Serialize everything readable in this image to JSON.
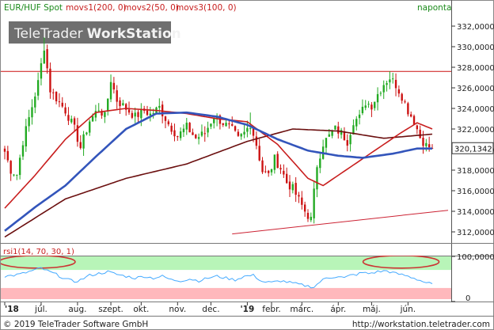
{
  "header": {
    "instrument": "EUR/HUF Spot",
    "indicators": [
      "movs1(200, 0)",
      "movs2(50, 0)",
      "movs3(100, 0)"
    ],
    "period": "naponta"
  },
  "watermark": {
    "brand_light": "TeleTrader",
    "brand_bold": "WorkStation"
  },
  "footer": {
    "copyright": "© 2019 TeleTrader Software GmbH",
    "url": "http://workstation.teletrader.com"
  },
  "colors": {
    "bull": "#22aa22",
    "bear": "#cc1111",
    "ma200": "#6b0f0f",
    "ma50": "#c81e1e",
    "ma100": "#3355bb",
    "trendline": "#cc2233",
    "rsi_line": "#44aaff",
    "overbought_band": "#b8f5b8",
    "oversold_band": "#ffb8bc",
    "ellipse": "#cc3333"
  },
  "chart_data": [
    {
      "type": "candlestick",
      "title": "EUR/HUF Spot",
      "period": "naponta",
      "yaxis_side": "right",
      "ylim": [
        311,
        333
      ],
      "yticks": [
        "332,0000",
        "330,0000",
        "328,0000",
        "326,0000",
        "324,0000",
        "322,0000",
        "320,0000",
        "318,0000",
        "316,0000",
        "314,0000",
        "312,0000"
      ],
      "ytick_values": [
        332,
        330,
        328,
        326,
        324,
        322,
        320,
        318,
        316,
        314,
        312
      ],
      "last_value": 320.1342,
      "last_value_label": "320,1342",
      "x_months": [
        "'18",
        "júl.",
        "aug.",
        "szept.",
        "okt.",
        "nov.",
        "dec.",
        "'19",
        "febr.",
        "márc.",
        "ápr.",
        "máj.",
        "jún."
      ],
      "x_month_index": [
        0,
        12,
        24,
        35,
        45,
        57,
        68,
        80,
        88,
        98,
        110,
        121,
        133
      ],
      "n_sessions": 142,
      "price_anchors": [
        [
          0,
          319.8
        ],
        [
          2,
          318.0
        ],
        [
          4,
          317.6
        ],
        [
          6,
          320.8
        ],
        [
          9,
          324.2
        ],
        [
          11,
          326.5
        ],
        [
          13,
          330.0
        ],
        [
          15,
          325.8
        ],
        [
          18,
          324.6
        ],
        [
          20,
          323.8
        ],
        [
          23,
          322.0
        ],
        [
          25,
          320.2
        ],
        [
          28,
          322.8
        ],
        [
          31,
          324.0
        ],
        [
          33,
          323.2
        ],
        [
          35,
          326.8
        ],
        [
          37,
          324.8
        ],
        [
          40,
          324.0
        ],
        [
          43,
          323.2
        ],
        [
          46,
          323.8
        ],
        [
          48,
          323.4
        ],
        [
          51,
          324.1
        ],
        [
          54,
          322.5
        ],
        [
          57,
          321.3
        ],
        [
          60,
          322.2
        ],
        [
          63,
          321.1
        ],
        [
          66,
          321.6
        ],
        [
          69,
          323.3
        ],
        [
          72,
          322.6
        ],
        [
          75,
          321.9
        ],
        [
          77,
          321.0
        ],
        [
          79,
          321.6
        ],
        [
          81,
          322.5
        ],
        [
          83,
          320.5
        ],
        [
          85,
          317.9
        ],
        [
          87,
          317.5
        ],
        [
          89,
          319.1
        ],
        [
          91,
          318.2
        ],
        [
          93,
          316.8
        ],
        [
          95,
          316.2
        ],
        [
          97,
          315.1
        ],
        [
          99,
          314.0
        ],
        [
          101,
          313.2
        ],
        [
          103,
          318.5
        ],
        [
          105,
          320.6
        ],
        [
          107,
          321.3
        ],
        [
          109,
          322.0
        ],
        [
          111,
          321.6
        ],
        [
          113,
          320.8
        ],
        [
          115,
          322.8
        ],
        [
          117,
          323.1
        ],
        [
          119,
          324.6
        ],
        [
          121,
          324.3
        ],
        [
          123,
          325.4
        ],
        [
          125,
          326.4
        ],
        [
          127,
          327.0
        ],
        [
          129,
          326.3
        ],
        [
          131,
          325.2
        ],
        [
          133,
          323.8
        ],
        [
          135,
          322.8
        ],
        [
          137,
          321.2
        ],
        [
          139,
          320.4
        ],
        [
          141,
          320.13
        ]
      ],
      "spike_highs": [
        [
          13,
          330.9
        ],
        [
          35,
          327.3
        ],
        [
          81,
          323.6
        ],
        [
          127,
          327.6
        ]
      ],
      "series": [
        {
          "name": "movs1(200, 0)",
          "type": "line",
          "points": [
            [
              0,
              311.5
            ],
            [
              20,
              315.2
            ],
            [
              40,
              317.2
            ],
            [
              60,
              318.6
            ],
            [
              80,
              320.8
            ],
            [
              95,
              322.0
            ],
            [
              110,
              321.8
            ],
            [
              125,
              321.1
            ],
            [
              141,
              321.5
            ]
          ]
        },
        {
          "name": "movs2(50, 0)",
          "type": "line",
          "points": [
            [
              0,
              314.3
            ],
            [
              10,
              317.5
            ],
            [
              20,
              321.0
            ],
            [
              30,
              323.6
            ],
            [
              40,
              324.0
            ],
            [
              50,
              323.8
            ],
            [
              60,
              323.5
            ],
            [
              70,
              323.0
            ],
            [
              80,
              322.7
            ],
            [
              90,
              320.5
            ],
            [
              100,
              317.2
            ],
            [
              105,
              316.5
            ],
            [
              110,
              317.5
            ],
            [
              120,
              319.5
            ],
            [
              130,
              321.5
            ],
            [
              136,
              322.6
            ],
            [
              141,
              322.0
            ]
          ]
        },
        {
          "name": "movs3(100, 0)",
          "type": "line",
          "points": [
            [
              0,
              312.1
            ],
            [
              10,
              314.4
            ],
            [
              20,
              316.5
            ],
            [
              30,
              319.3
            ],
            [
              40,
              322.0
            ],
            [
              50,
              323.5
            ],
            [
              60,
              323.6
            ],
            [
              70,
              323.2
            ],
            [
              80,
              322.4
            ],
            [
              90,
              321.0
            ],
            [
              100,
              319.9
            ],
            [
              110,
              319.4
            ],
            [
              118,
              319.2
            ],
            [
              128,
              319.6
            ],
            [
              136,
              320.1
            ],
            [
              141,
              320.1
            ]
          ]
        }
      ],
      "horizontal_lines": [
        327.6
      ],
      "trendline": {
        "from": [
          75,
          311.8
        ],
        "to": [
          141,
          314.1
        ]
      }
    },
    {
      "type": "line",
      "title": "rsi1(14, 70, 30, 1)",
      "yaxis_side": "right",
      "ylim": [
        0,
        100
      ],
      "yticks": [
        "100,0000",
        "0"
      ],
      "ytick_values": [
        100,
        0
      ],
      "bands": [
        {
          "from": 70,
          "to": 100,
          "color": "overbought"
        },
        {
          "from": 0,
          "to": 30,
          "color": "oversold"
        }
      ],
      "rsi_anchors": [
        [
          0,
          56
        ],
        [
          3,
          58
        ],
        [
          6,
          62
        ],
        [
          9,
          68
        ],
        [
          12,
          74
        ],
        [
          14,
          68
        ],
        [
          17,
          60
        ],
        [
          20,
          50
        ],
        [
          23,
          44
        ],
        [
          25,
          48
        ],
        [
          28,
          58
        ],
        [
          31,
          62
        ],
        [
          34,
          66
        ],
        [
          37,
          60
        ],
        [
          40,
          56
        ],
        [
          43,
          52
        ],
        [
          46,
          56
        ],
        [
          49,
          52
        ],
        [
          52,
          56
        ],
        [
          55,
          48
        ],
        [
          58,
          46
        ],
        [
          61,
          50
        ],
        [
          64,
          46
        ],
        [
          67,
          52
        ],
        [
          70,
          56
        ],
        [
          73,
          52
        ],
        [
          76,
          48
        ],
        [
          79,
          56
        ],
        [
          82,
          58
        ],
        [
          85,
          44
        ],
        [
          88,
          42
        ],
        [
          91,
          46
        ],
        [
          94,
          42
        ],
        [
          97,
          38
        ],
        [
          100,
          34
        ],
        [
          102,
          32
        ],
        [
          104,
          44
        ],
        [
          106,
          52
        ],
        [
          108,
          54
        ],
        [
          110,
          56
        ],
        [
          112,
          52
        ],
        [
          114,
          58
        ],
        [
          116,
          60
        ],
        [
          118,
          64
        ],
        [
          120,
          62
        ],
        [
          123,
          66
        ],
        [
          126,
          68
        ],
        [
          129,
          62
        ],
        [
          132,
          58
        ],
        [
          135,
          52
        ],
        [
          138,
          44
        ],
        [
          141,
          38
        ]
      ],
      "highlight_ellipses": [
        {
          "center_x": 6,
          "center_rsi": 88
        },
        {
          "center_x": 126,
          "center_rsi": 88
        }
      ]
    }
  ]
}
